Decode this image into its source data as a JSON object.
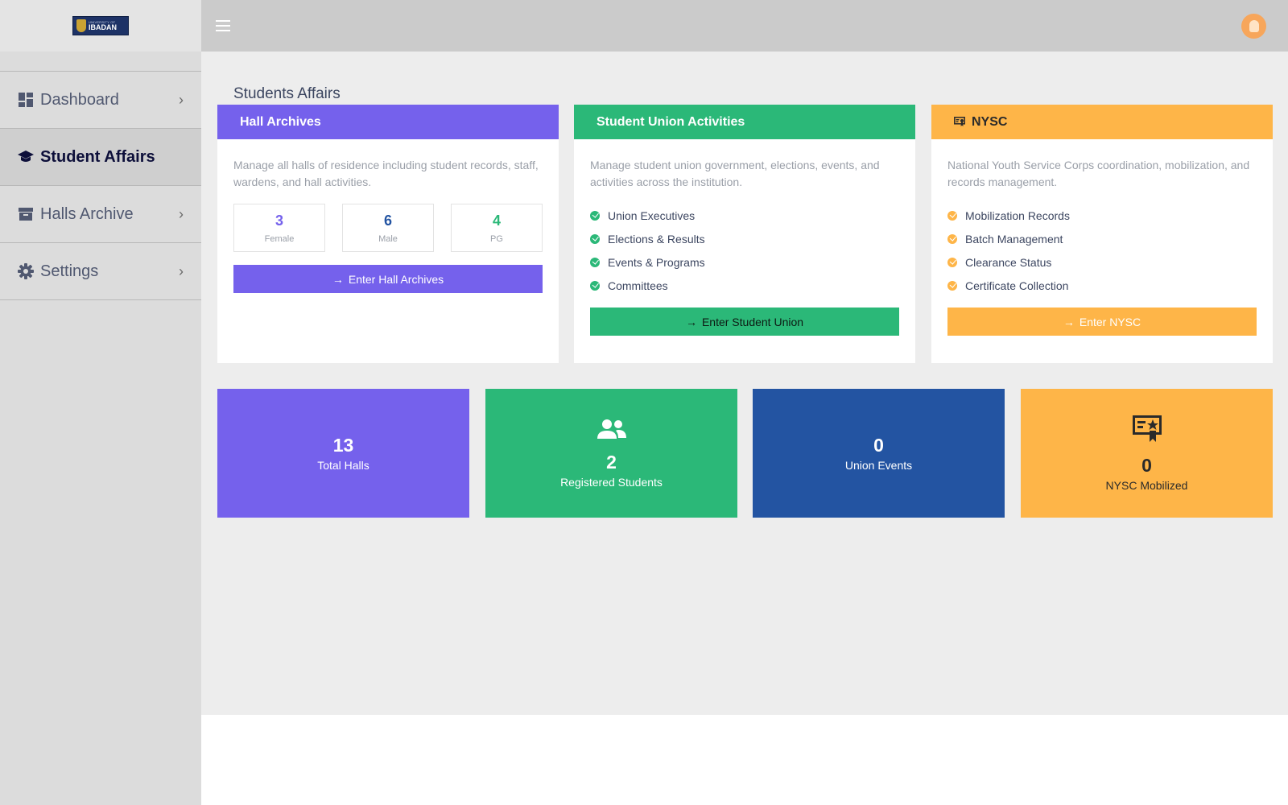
{
  "colors": {
    "purple": "#7561ec",
    "green": "#2bb878",
    "orange": "#feb548",
    "blue": "#2354a2",
    "sidebar_bg": "#dcdcdc",
    "topbar_bg": "#cbcbcb"
  },
  "brand": {
    "logo_small": "UNIVERSITY OF",
    "logo_big": "IBADAN"
  },
  "sidebar": {
    "items": [
      {
        "label": "Dashboard",
        "icon": "dashboard-icon",
        "active": false
      },
      {
        "label": "Student Affairs",
        "icon": "graduation-cap-icon",
        "active": true
      },
      {
        "label": "Halls Archive",
        "icon": "archive-icon",
        "active": false
      },
      {
        "label": "Settings",
        "icon": "gear-icon",
        "active": false
      }
    ]
  },
  "header": {
    "menu_icon": "hamburger-menu-icon",
    "avatar_icon": "user-avatar-icon"
  },
  "page": {
    "title": "Students Affairs"
  },
  "cards": {
    "halls": {
      "title": "Hall Archives",
      "description": "Manage all halls of residence including student records, staff, wardens, and hall activities.",
      "stats": [
        {
          "value": "3",
          "label": "Female",
          "color": "#7561ec"
        },
        {
          "value": "6",
          "label": "Male",
          "color": "#2354a2"
        },
        {
          "value": "4",
          "label": "PG",
          "color": "#2bb878"
        }
      ],
      "button": "Enter Hall Archives"
    },
    "union": {
      "title": "Student Union Activities",
      "description": "Manage student union government, elections, events, and activities across the institution.",
      "features": [
        "Union Executives",
        "Elections & Results",
        "Events & Programs",
        "Committees"
      ],
      "button": "Enter Student Union"
    },
    "nysc": {
      "title": "NYSC",
      "icon": "certificate-icon",
      "description": "National Youth Service Corps coordination, mobilization, and records management.",
      "features": [
        "Mobilization Records",
        "Batch Management",
        "Clearance Status",
        "Certificate Collection"
      ],
      "button": "Enter NYSC"
    }
  },
  "tiles": [
    {
      "value": "13",
      "label": "Total Halls"
    },
    {
      "value": "2",
      "label": "Registered Students",
      "icon": "users-icon"
    },
    {
      "value": "0",
      "label": "Union Events"
    },
    {
      "value": "0",
      "label": "NYSC Mobilized",
      "icon": "certificate-icon"
    }
  ]
}
